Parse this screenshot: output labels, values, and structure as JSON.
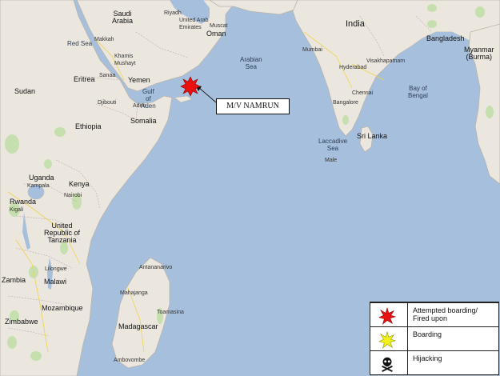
{
  "map": {
    "labels": {
      "saudi_arabia": "Saudi\nArabia",
      "uae": "United Arab\nEmirates",
      "oman": "Oman",
      "india": "India",
      "bangladesh": "Bangladesh",
      "myanmar": "Myanmar\n(Burma)",
      "red_sea": "Red Sea",
      "sudan": "Sudan",
      "eritrea": "Eritrea",
      "yemen": "Yemen",
      "djibouti": "Djibouti",
      "gulf_of_aden": "Gulf\nof\nAden",
      "ethiopia": "Ethiopia",
      "somalia": "Somalia",
      "arabian_sea": "Arabian\nSea",
      "bay_of_bengal": "Bay of\nBengal",
      "sri_lanka": "Sri Lanka",
      "laccadive_sea": "Laccadive\nSea",
      "uganda": "Uganda",
      "kenya": "Kenya",
      "rwanda": "Rwanda",
      "tanzania": "United\nRepublic of\nTanzania",
      "zambia": "Zambia",
      "malawi": "Malawi",
      "mozambique": "Mozambique",
      "zimbabwe": "Zimbabwe",
      "madagascar": "Madagascar",
      "riyadh": "Riyadh",
      "muscat": "Muscat",
      "makkah": "Makkah",
      "khamis_mushayt": "Khamis\nMushayt",
      "sanaa": "Sanaa",
      "aden": "Aden",
      "mumbai": "Mumbai",
      "hyderabad": "Hyderabad",
      "chennai": "Chennai",
      "bangalore": "Bangalore",
      "visakhapatnam": "Visakhapatnam",
      "male": "Male",
      "nairobi": "Nairobi",
      "kampala": "Kampala",
      "kigali": "Kigali",
      "lilongwe": "Lilongwe",
      "antananarivo": "Antananarivo",
      "toamasina": "Toamasina",
      "ambovombe": "Ambovombe",
      "mahajanga": "Mahajanga"
    },
    "incident_callout": "M/V NAMRUN"
  },
  "legend": {
    "items": [
      {
        "icon": "attempted-boarding-star-icon",
        "color": "#e81010",
        "label": "Attempted boarding/\nFired upon"
      },
      {
        "icon": "boarding-star-icon",
        "color": "#f2f21a",
        "label": "Boarding"
      },
      {
        "icon": "skull-crossbones-icon",
        "color": "#111111",
        "label": "Hijacking"
      }
    ]
  }
}
